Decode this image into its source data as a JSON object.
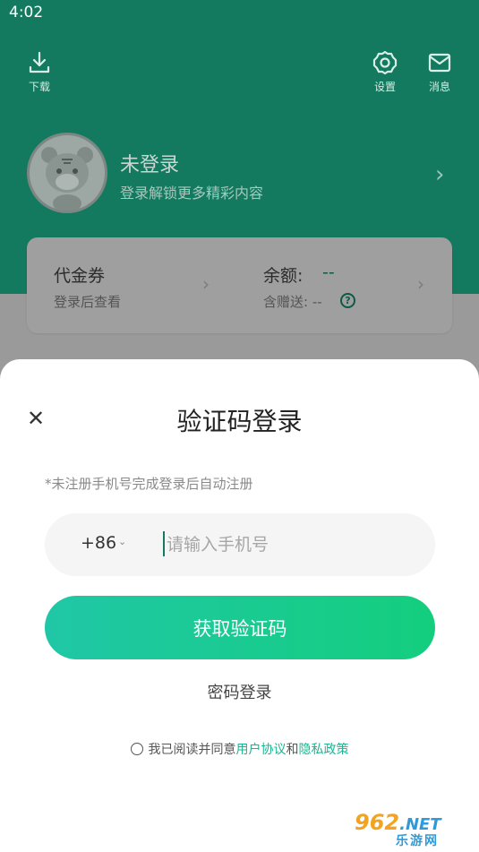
{
  "status_bar": {
    "time": "4:02"
  },
  "header": {
    "download_label": "下载",
    "settings_label": "设置",
    "messages_label": "消息"
  },
  "profile": {
    "name": "未登录",
    "subtitle": "登录解锁更多精彩内容"
  },
  "wallet": {
    "voucher_label": "代金券",
    "voucher_sub": "登录后查看",
    "balance_label": "余额:",
    "balance_value": "--",
    "gift_label": "含赠送: --"
  },
  "login_sheet": {
    "title": "验证码登录",
    "hint": "*未注册手机号完成登录后自动注册",
    "country_code": "+86",
    "phone_placeholder": "请输入手机号",
    "phone_value": "",
    "get_code_label": "获取验证码",
    "password_login_label": "密码登录",
    "agreement_prefix": "我已阅读并同意",
    "user_agreement": "用户协议",
    "agreement_and": "和",
    "privacy_policy": "隐私政策"
  },
  "watermark": {
    "top": "962",
    "net": ".NET",
    "bottom": "乐游网"
  },
  "colors": {
    "brand_green": "#1cc28f",
    "header_green_dimmed": "#137a60",
    "link_green": "#19b591"
  }
}
